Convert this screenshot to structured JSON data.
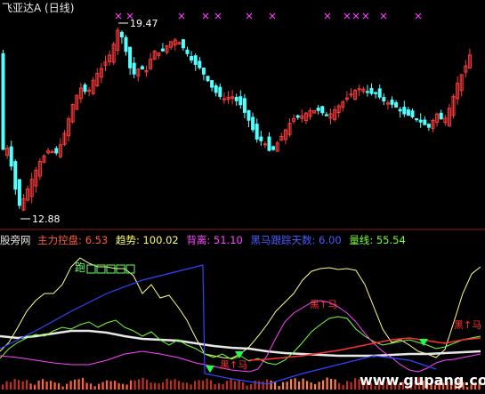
{
  "title": "飞亚达A (日线)",
  "price_chart": {
    "high_label": "19.47",
    "low_label": "12.88",
    "high_value": 19.47,
    "low_value": 12.88,
    "colors": {
      "up": "#ff3b3b",
      "down": "#54ffff",
      "marker": "#ff3cff"
    }
  },
  "indicator": {
    "source": "股旁网",
    "items": [
      {
        "label": "主力控盘",
        "value": "6.53",
        "color": "#ff5a32"
      },
      {
        "label": "趋势",
        "value": "100.02",
        "color": "#ffff66"
      },
      {
        "label": "背离",
        "value": "51.10",
        "color": "#ff44ff"
      },
      {
        "label": "黑马跟踪天数",
        "value": "6.00",
        "color": "#4a5cff"
      },
      {
        "label": "量线",
        "value": "55.54",
        "color": "#77ff33"
      }
    ],
    "annotations": [
      "跑",
      "黑↑马",
      "黑↑马",
      "黑↑马"
    ]
  },
  "watermark": "www.gupang.com"
}
